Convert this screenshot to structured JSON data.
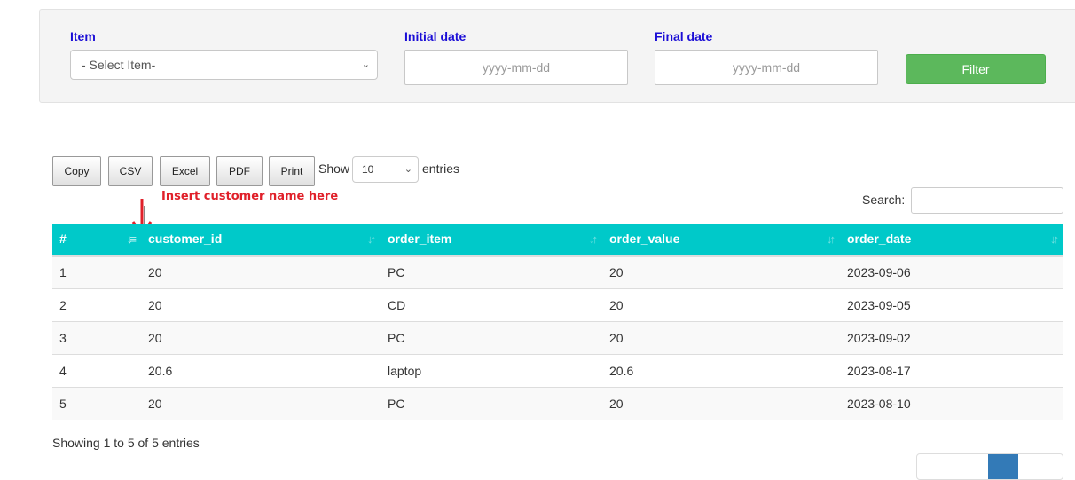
{
  "filters": {
    "item_label": "Item",
    "item_select_value": "- Select Item-",
    "initial_date_label": "Initial date",
    "initial_date_placeholder": "yyyy-mm-dd",
    "final_date_label": "Final date",
    "final_date_placeholder": "yyyy-mm-dd",
    "filter_button": "Filter"
  },
  "toolbar": {
    "buttons": [
      "Copy",
      "CSV",
      "Excel",
      "PDF",
      "Print"
    ],
    "show_label": "Show",
    "page_length_value": "10",
    "entries_label": "entries",
    "search_label": "Search:",
    "search_value": ""
  },
  "annotation": {
    "text": "Insert customer name here",
    "color": "#e0202a"
  },
  "table": {
    "header_color": "#00c9c9",
    "columns": [
      "#",
      "customer_id",
      "order_item",
      "order_value",
      "order_date"
    ],
    "rows": [
      [
        "1",
        "20",
        "PC",
        "20",
        "2023-09-06"
      ],
      [
        "2",
        "20",
        "CD",
        "20",
        "2023-09-05"
      ],
      [
        "3",
        "20",
        "PC",
        "20",
        "2023-09-02"
      ],
      [
        "4",
        "20.6",
        "laptop",
        "20.6",
        "2023-08-17"
      ],
      [
        "5",
        "20",
        "PC",
        "20",
        "2023-08-10"
      ]
    ]
  },
  "footer": {
    "info": "Showing 1 to 5 of 5 entries",
    "active_page_color": "#337ab7"
  }
}
